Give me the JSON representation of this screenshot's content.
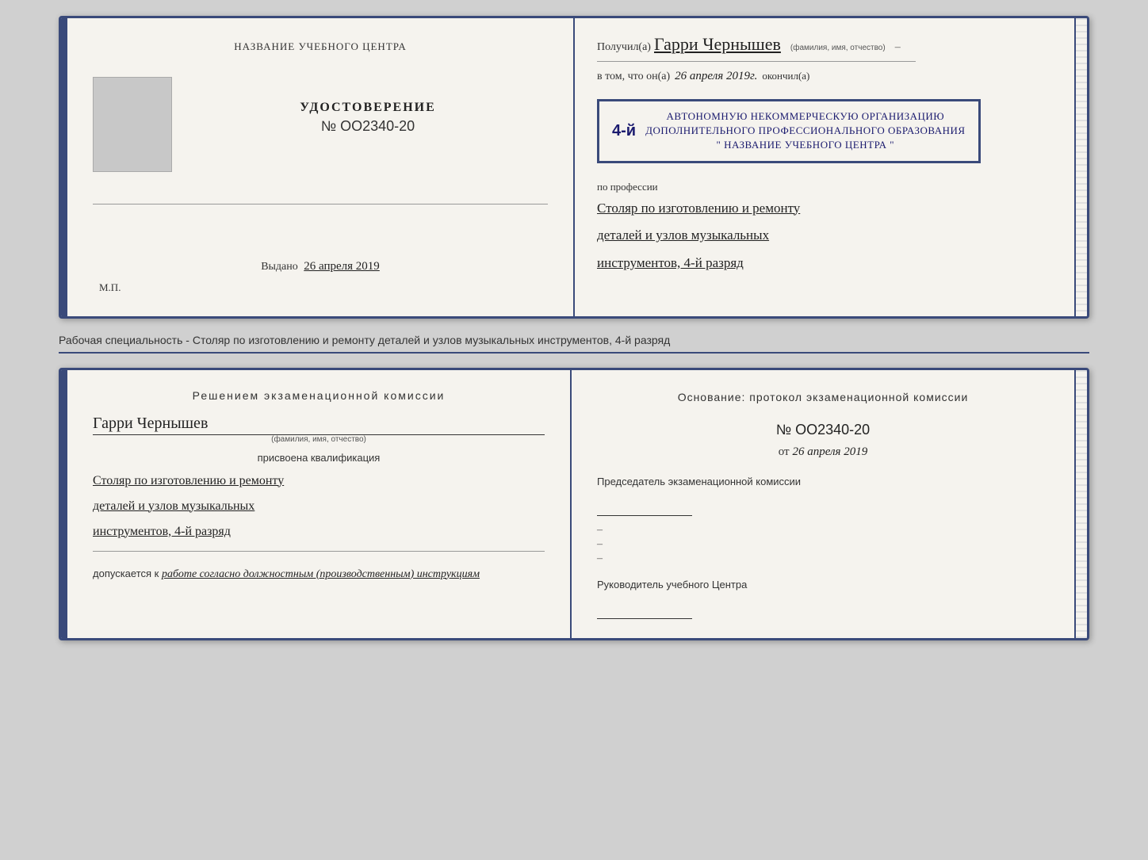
{
  "top_doc": {
    "left": {
      "center_title": "НАЗВАНИЕ УЧЕБНОГО ЦЕНТРА",
      "udost_label": "УДОСТОВЕРЕНИЕ",
      "udost_number": "№ OO2340-20",
      "vydano_label": "Выдано",
      "vydano_date": "26 апреля 2019",
      "mp_label": "М.П."
    },
    "right": {
      "poluchil_prefix": "Получил(а)",
      "recipient_name": "Гарри Чернышев",
      "fio_label": "(фамилия, имя, отчество)",
      "vtom_prefix": "в том, что он(а)",
      "vtom_date": "26 апреля 2019г.",
      "okonchil": "окончил(а)",
      "stamp_number": "4-й",
      "stamp_line1": "АВТОНОМНУЮ НЕКОММЕРЧЕСКУЮ ОРГАНИЗАЦИЮ",
      "stamp_line2": "ДОПОЛНИТЕЛЬНОГО ПРОФЕССИОНАЛЬНОГО ОБРАЗОВАНИЯ",
      "stamp_line3": "\" НАЗВАНИЕ УЧЕБНОГО ЦЕНТРА \"",
      "po_professii": "по профессии",
      "profession_line1": "Столяр по изготовлению и ремонту",
      "profession_line2": "деталей и узлов музыкальных",
      "profession_line3": "инструментов, 4-й разряд"
    }
  },
  "caption": "Рабочая специальность - Столяр по изготовлению и ремонту деталей и узлов музыкальных инструментов, 4-й разряд",
  "bottom_doc": {
    "left": {
      "resheniem_title": "Решением  экзаменационной  комиссии",
      "name": "Гарри Чернышев",
      "fio_label": "(фамилия, имя, отчество)",
      "prisvoena": "присвоена квалификация",
      "qual_line1": "Столяр по изготовлению и ремонту",
      "qual_line2": "деталей и узлов музыкальных",
      "qual_line3": "инструментов, 4-й разряд",
      "dopuskaetsya_prefix": "допускается к",
      "dopuskaetsya_text": "работе согласно должностным (производственным) инструкциям"
    },
    "right": {
      "osnovanie_text": "Основание: протокол экзаменационной  комиссии",
      "protocol_number": "№  OO2340-20",
      "ot_prefix": "от",
      "ot_date": "26 апреля 2019",
      "predsedatel_title": "Председатель экзаменационной комиссии",
      "rukovoditel_title": "Руководитель учебного Центра"
    }
  }
}
